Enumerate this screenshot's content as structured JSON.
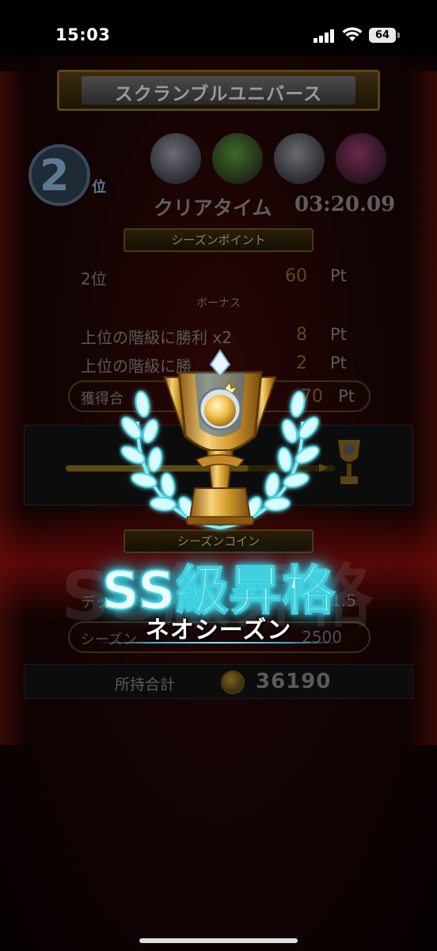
{
  "status_bar": {
    "time": "15:03",
    "battery": "64"
  },
  "header": {
    "title": "スクランブルユニバース"
  },
  "result": {
    "rank_number": "2",
    "rank_suffix": "位",
    "clear_time_label": "クリアタイム",
    "clear_time_value": "03:20.09"
  },
  "season_point": {
    "section_label": "シーズンポイント",
    "rank_row": {
      "label": "2位",
      "value": "60",
      "unit": "Pt"
    },
    "bonus_label": "ボーナス",
    "bonus_rows": [
      {
        "label": "上位の階級に勝利 x2",
        "value": "8",
        "unit": "Pt"
      },
      {
        "label": "上位の階級に勝",
        "value": "2",
        "unit": "Pt"
      }
    ],
    "total": {
      "label": "獲得合",
      "value": "70",
      "unit": "Pt"
    },
    "progress_fraction": 0.68
  },
  "season_coin": {
    "section_label": "シーズンコイン",
    "row1": {
      "label": "デッキボーナス",
      "value": "x1.5"
    },
    "row2": {
      "label": "シーズン",
      "value": "2500"
    },
    "owned_label": "所持合計",
    "owned_value": "36190"
  },
  "promotion": {
    "title": "SS級昇格",
    "season_name": "ネオシーズン"
  },
  "colors": {
    "glow": "#5ff0ff",
    "gold": "#e0a83a",
    "laurel": "#bff6ff"
  },
  "icons": [
    "signal-icon",
    "wifi-icon",
    "battery-icon",
    "trophy-icon",
    "laurel-wreath-icon",
    "coin-icon"
  ]
}
